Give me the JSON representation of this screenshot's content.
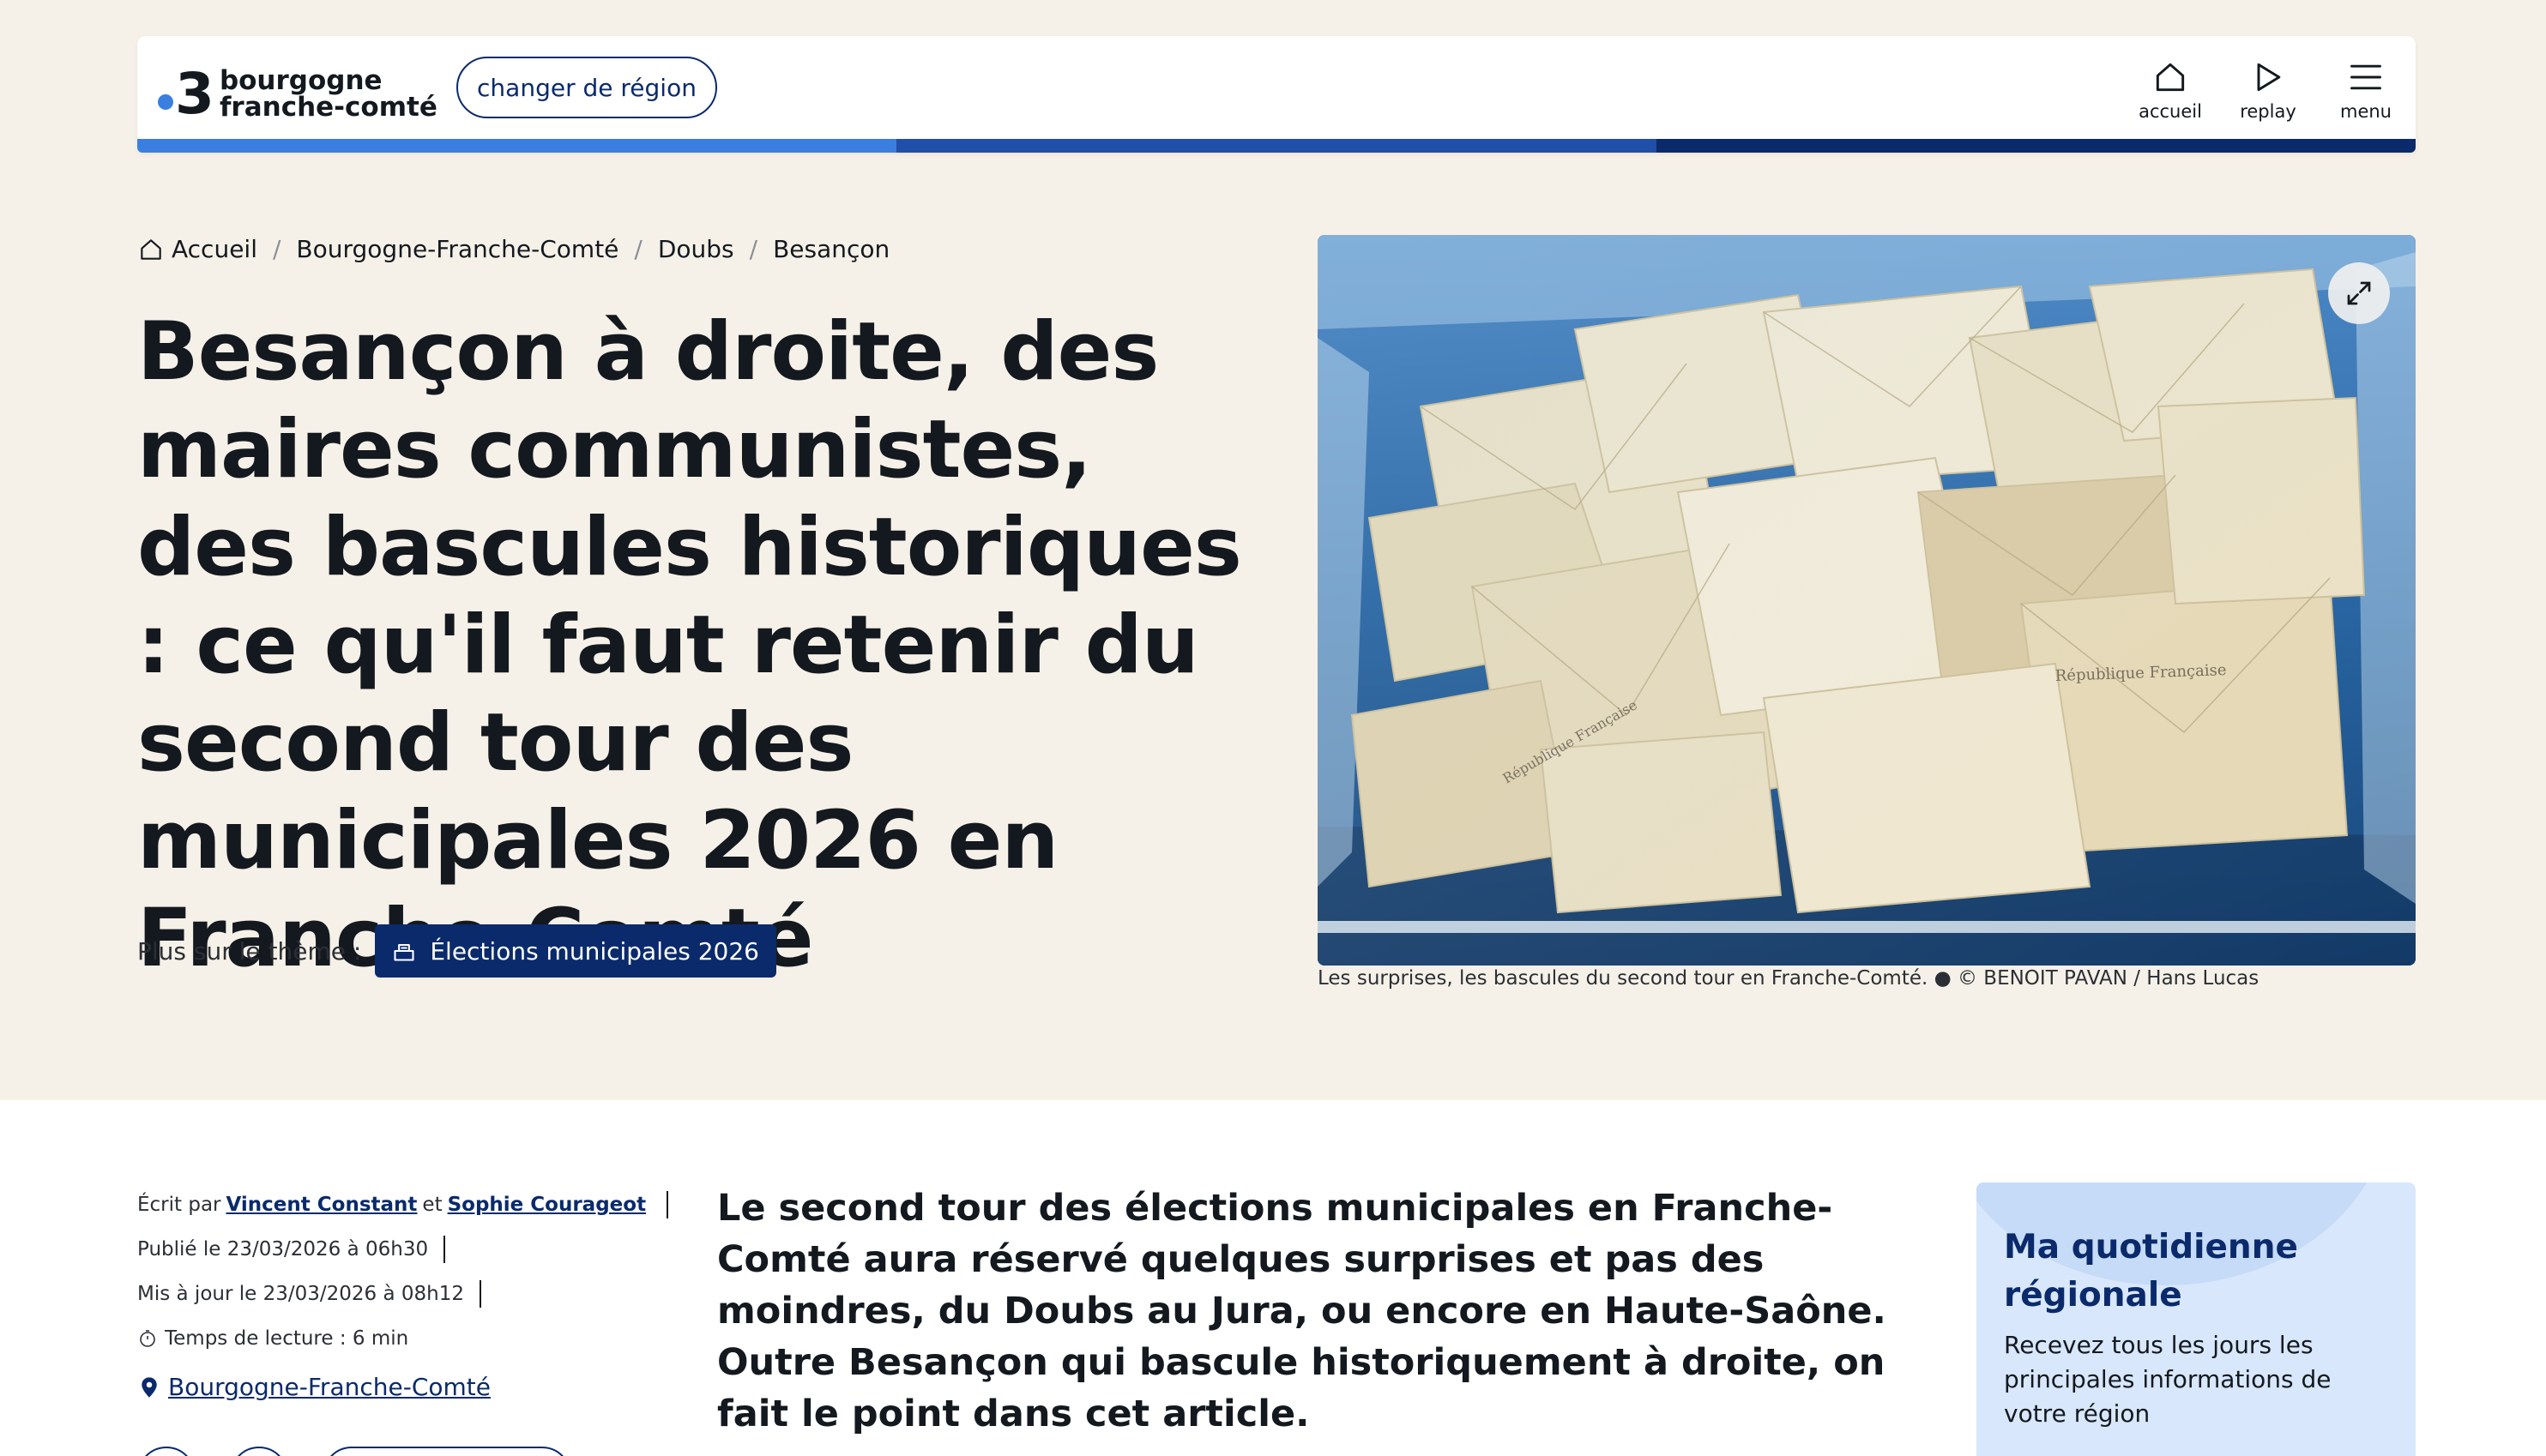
{
  "header": {
    "logo_number": "3",
    "logo_line1": "bourgogne",
    "logo_line2": "franche-comté",
    "region_button": "changer de région",
    "nav": [
      {
        "label": "accueil",
        "icon": "home-icon"
      },
      {
        "label": "replay",
        "icon": "play-icon"
      },
      {
        "label": "menu",
        "icon": "hamburger-menu-icon"
      }
    ],
    "bar_colors": [
      "#3a7fe0",
      "#1f4fa8",
      "#0a2a6b"
    ]
  },
  "breadcrumb": [
    "Accueil",
    "Bourgogne-Franche-Comté",
    "Doubs",
    "Besançon"
  ],
  "title": "Besançon à droite, des maires communistes, des bascules historiques : ce qu'il faut retenir du second tour des municipales 2026 en Franche-Comté",
  "theme": {
    "label": "Plus sur le thème :",
    "tag": "Élections municipales 2026",
    "tag_icon": "ballot-box-icon"
  },
  "photo": {
    "alt": "Les surprises, les bascules du second tour en Franche-Comté.",
    "envelope_text": "République Française"
  },
  "caption": "Les surprises, les bascules du second tour en Franche-Comté. ● © BENOIT PAVAN / Hans Lucas",
  "meta": {
    "written_by": "Écrit par",
    "author1": "Vincent Constant",
    "and": "et",
    "author2": "Sophie Courageot",
    "published": "Publié le 23/03/2026 à 06h30",
    "updated": "Mis à jour le 23/03/2026 à 08h12",
    "reading_time": "Temps de lecture : 6 min",
    "location": "Bourgogne-Franche-Comté"
  },
  "lead": "Le second tour des élections municipales en Franche-Comté aura réservé quelques surprises et pas des moindres, du Doubs au Jura, ou encore en Haute-Saône. Outre Besançon qui bascule historiquement à droite, on fait le point dans cet article.",
  "newsletter": {
    "title": "Ma quotidienne régionale",
    "text": "Recevez tous les jours les principales informations de votre région"
  },
  "colors": {
    "brand_dark": "#0a2a6b",
    "brand_light": "#3a7fe0",
    "background": "#f6f1e8"
  }
}
